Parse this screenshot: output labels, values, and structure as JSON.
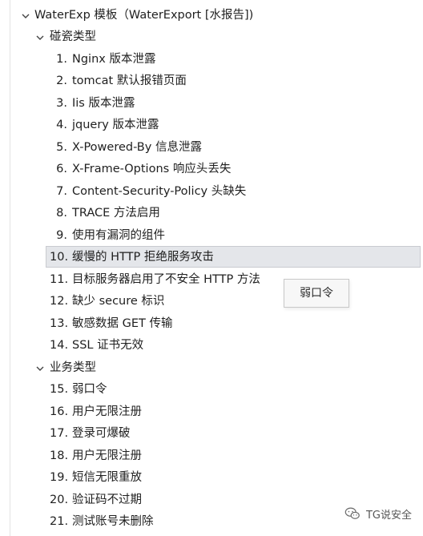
{
  "tree": {
    "root": {
      "label": "WaterExp 模板（WaterExport [水报告])",
      "expanded": true,
      "children": [
        {
          "label": "碰瓷类型",
          "expanded": true,
          "items": [
            {
              "num": "1.",
              "text": "Nginx 版本泄露"
            },
            {
              "num": "2.",
              "text": "tomcat 默认报错页面"
            },
            {
              "num": "3.",
              "text": "Iis 版本泄露"
            },
            {
              "num": "4.",
              "text": "jquery 版本泄露"
            },
            {
              "num": "5.",
              "text": "X-Powered-By 信息泄露"
            },
            {
              "num": "6.",
              "text": "X-Frame-Options 响应头丢失"
            },
            {
              "num": "7.",
              "text": "Content-Security-Policy 头缺失"
            },
            {
              "num": "8.",
              "text": "TRACE 方法启用"
            },
            {
              "num": "9.",
              "text": "使用有漏洞的组件"
            },
            {
              "num": "10.",
              "text": "缓慢的 HTTP 拒绝服务攻击"
            },
            {
              "num": "11.",
              "text": "目标服务器启用了不安全 HTTP 方法"
            },
            {
              "num": "12.",
              "text": "缺少 secure 标识"
            },
            {
              "num": "13.",
              "text": "敏感数据 GET 传输"
            },
            {
              "num": "14.",
              "text": "SSL 证书无效"
            }
          ]
        },
        {
          "label": "业务类型",
          "expanded": true,
          "items": [
            {
              "num": "15.",
              "text": "弱口令"
            },
            {
              "num": "16.",
              "text": "用户无限注册"
            },
            {
              "num": "17.",
              "text": "登录可爆破"
            },
            {
              "num": "18.",
              "text": "用户无限注册"
            },
            {
              "num": "19.",
              "text": "短信无限重放"
            },
            {
              "num": "20.",
              "text": "验证码不过期"
            },
            {
              "num": "21.",
              "text": "测试账号未删除"
            }
          ]
        }
      ]
    },
    "selected_item": "10."
  },
  "tooltip": {
    "text": "弱口令"
  },
  "watermark": {
    "text": "TG说安全",
    "icon": "wechat-icon"
  },
  "colors": {
    "selected_bg": "#e4e6ea",
    "selected_border": "#c9cbd0",
    "text": "#1f1f1f"
  }
}
